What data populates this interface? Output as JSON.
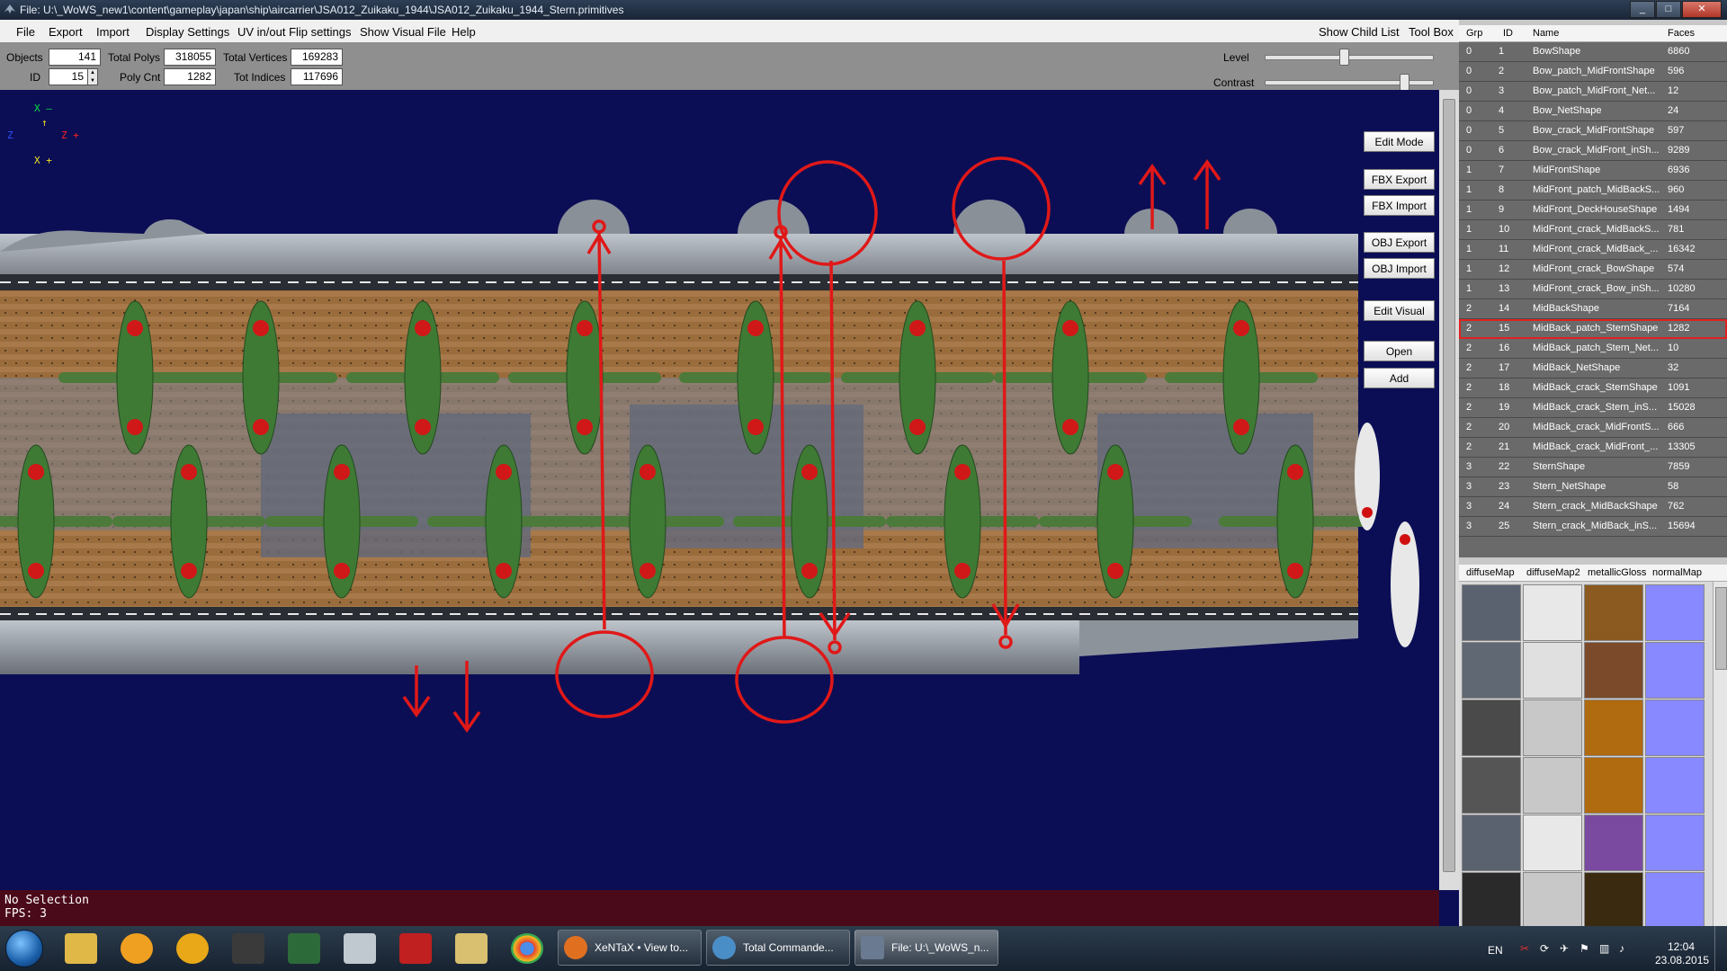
{
  "window": {
    "title": "File: U:\\_WoWS_new1\\content\\gameplay\\japan\\ship\\aircarrier\\JSA012_Zuikaku_1944\\JSA012_Zuikaku_1944_Stern.primitives",
    "minimize": "_",
    "maximize": "□",
    "close": "✕"
  },
  "menu": {
    "file": "File",
    "export": "Export",
    "import": "Import",
    "display_settings": "Display Settings",
    "uv_flip": "UV in/out Flip settings",
    "show_visual": "Show Visual File",
    "help": "Help",
    "show_child_list": "Show Child List",
    "tool_box": "Tool Box"
  },
  "stats": {
    "objects_label": "Objects",
    "objects": "141",
    "total_polys_label": "Total Polys",
    "total_polys": "318055",
    "total_vertices_label": "Total Vertices",
    "total_vertices": "169283",
    "id_label": "ID",
    "id": "15",
    "poly_cnt_label": "Poly Cnt",
    "poly_cnt": "1282",
    "tot_indices_label": "Tot Indices",
    "tot_indices": "117696",
    "level_label": "Level",
    "contrast_label": "Contrast",
    "level_value": 0.47,
    "contrast_value": 0.83
  },
  "viewport": {
    "gizmo_x": "X",
    "gizmo_z": "Z",
    "gizmo_dash": "–",
    "gizmo_plus": "+",
    "buttons": {
      "edit_mode": "Edit Mode",
      "fbx_export": "FBX Export",
      "fbx_import": "FBX Import",
      "obj_export": "OBJ Export",
      "obj_import": "OBJ Import",
      "edit_visual": "Edit Visual",
      "open": "Open",
      "add": "Add"
    }
  },
  "console": {
    "line1": "No Selection",
    "line2": "FPS: 3"
  },
  "object_grid": {
    "headers": {
      "grp": "Grp",
      "id": "ID",
      "name": "Name",
      "faces": "Faces"
    },
    "rows": [
      {
        "grp": "0",
        "id": "1",
        "name": "BowShape",
        "faces": "6860"
      },
      {
        "grp": "0",
        "id": "2",
        "name": "Bow_patch_MidFrontShape",
        "faces": "596"
      },
      {
        "grp": "0",
        "id": "3",
        "name": "Bow_patch_MidFront_Net...",
        "faces": "12"
      },
      {
        "grp": "0",
        "id": "4",
        "name": "Bow_NetShape",
        "faces": "24"
      },
      {
        "grp": "0",
        "id": "5",
        "name": "Bow_crack_MidFrontShape",
        "faces": "597"
      },
      {
        "grp": "0",
        "id": "6",
        "name": "Bow_crack_MidFront_inSh...",
        "faces": "9289"
      },
      {
        "grp": "1",
        "id": "7",
        "name": "MidFrontShape",
        "faces": "6936"
      },
      {
        "grp": "1",
        "id": "8",
        "name": "MidFront_patch_MidBackS...",
        "faces": "960"
      },
      {
        "grp": "1",
        "id": "9",
        "name": "MidFront_DeckHouseShape",
        "faces": "1494"
      },
      {
        "grp": "1",
        "id": "10",
        "name": "MidFront_crack_MidBackS...",
        "faces": "781"
      },
      {
        "grp": "1",
        "id": "11",
        "name": "MidFront_crack_MidBack_...",
        "faces": "16342"
      },
      {
        "grp": "1",
        "id": "12",
        "name": "MidFront_crack_BowShape",
        "faces": "574"
      },
      {
        "grp": "1",
        "id": "13",
        "name": "MidFront_crack_Bow_inSh...",
        "faces": "10280"
      },
      {
        "grp": "2",
        "id": "14",
        "name": "MidBackShape",
        "faces": "7164"
      },
      {
        "grp": "2",
        "id": "15",
        "name": "MidBack_patch_SternShape",
        "faces": "1282"
      },
      {
        "grp": "2",
        "id": "16",
        "name": "MidBack_patch_Stern_Net...",
        "faces": "10"
      },
      {
        "grp": "2",
        "id": "17",
        "name": "MidBack_NetShape",
        "faces": "32"
      },
      {
        "grp": "2",
        "id": "18",
        "name": "MidBack_crack_SternShape",
        "faces": "1091"
      },
      {
        "grp": "2",
        "id": "19",
        "name": "MidBack_crack_Stern_inS...",
        "faces": "15028"
      },
      {
        "grp": "2",
        "id": "20",
        "name": "MidBack_crack_MidFrontS...",
        "faces": "666"
      },
      {
        "grp": "2",
        "id": "21",
        "name": "MidBack_crack_MidFront_...",
        "faces": "13305"
      },
      {
        "grp": "3",
        "id": "22",
        "name": "SternShape",
        "faces": "7859"
      },
      {
        "grp": "3",
        "id": "23",
        "name": "Stern_NetShape",
        "faces": "58"
      },
      {
        "grp": "3",
        "id": "24",
        "name": "Stern_crack_MidBackShape",
        "faces": "762"
      },
      {
        "grp": "3",
        "id": "25",
        "name": "Stern_crack_MidBack_inS...",
        "faces": "15694"
      }
    ]
  },
  "texture_grid": {
    "headers": {
      "diffuse": "diffuseMap",
      "diffuse2": "diffuseMap2",
      "metallic": "metallicGloss",
      "normal": "normalMap"
    }
  },
  "taskbar": {
    "tasks": [
      {
        "label": "XeNTaX • View to..."
      },
      {
        "label": "Total Commande..."
      },
      {
        "label": "File: U:\\_WoWS_n..."
      }
    ],
    "language": "EN",
    "time": "12:04",
    "date": "23.08.2015"
  },
  "colors": {
    "viewport_bg": "#0b0e55",
    "console_bg": "#4a0a1a",
    "annotation_red": "#e01818",
    "grid_bg": "#6a6a6a"
  }
}
